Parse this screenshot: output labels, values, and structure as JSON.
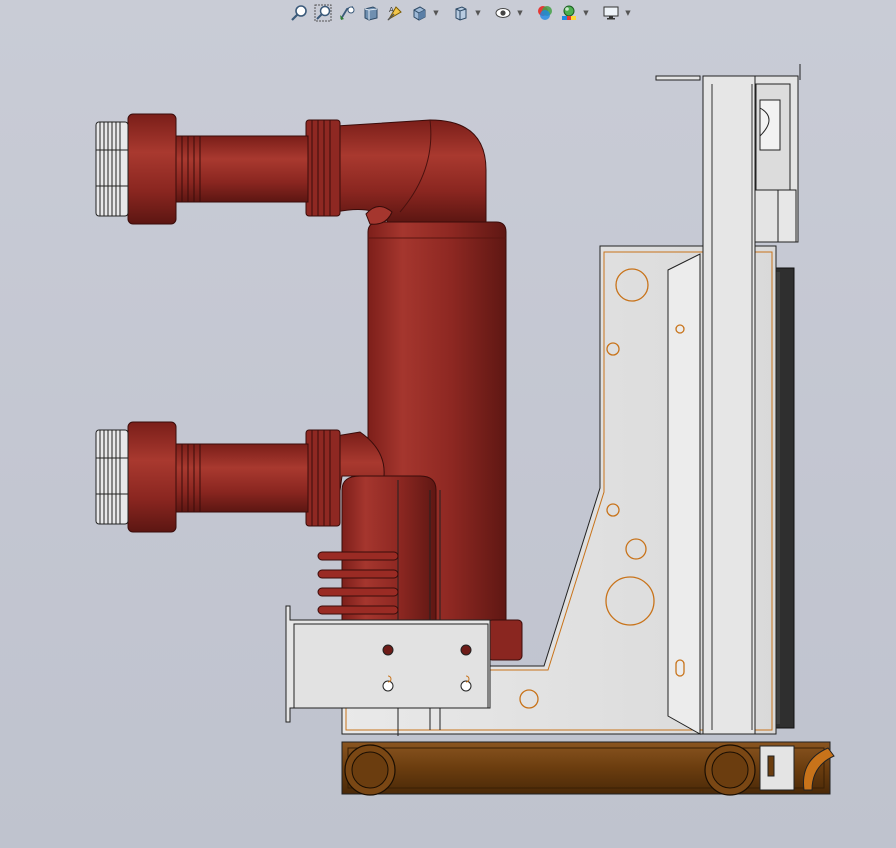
{
  "app": {
    "type": "3D CAD heads-up view toolbar"
  },
  "toolbar": {
    "items": [
      {
        "name": "zoom-to-fit-icon",
        "caret": false
      },
      {
        "name": "zoom-to-area-icon",
        "caret": false
      },
      {
        "name": "previous-view-icon",
        "caret": false
      },
      {
        "name": "section-view-icon",
        "caret": false
      },
      {
        "name": "dynamic-annotation-icon",
        "caret": false
      },
      {
        "name": "view-orientation-icon",
        "caret": true
      },
      {
        "name": "display-style-icon",
        "caret": true
      },
      {
        "name": "hide-show-items-icon",
        "caret": true
      },
      {
        "name": "edit-appearance-icon",
        "caret": false
      },
      {
        "name": "apply-scene-icon",
        "caret": true
      },
      {
        "name": "view-settings-icon",
        "caret": true
      }
    ]
  },
  "colors": {
    "background": "#c5c8d2",
    "insulator_red": "#9a2b24",
    "insulator_shadow": "#6e1c18",
    "contact_silver": "#e8e8ea",
    "frame_gray": "#e2e2e2",
    "highlight_orange": "#c8731a",
    "trolley_brown": "#6b3d0f",
    "panel_dark": "#2f2f2f"
  }
}
